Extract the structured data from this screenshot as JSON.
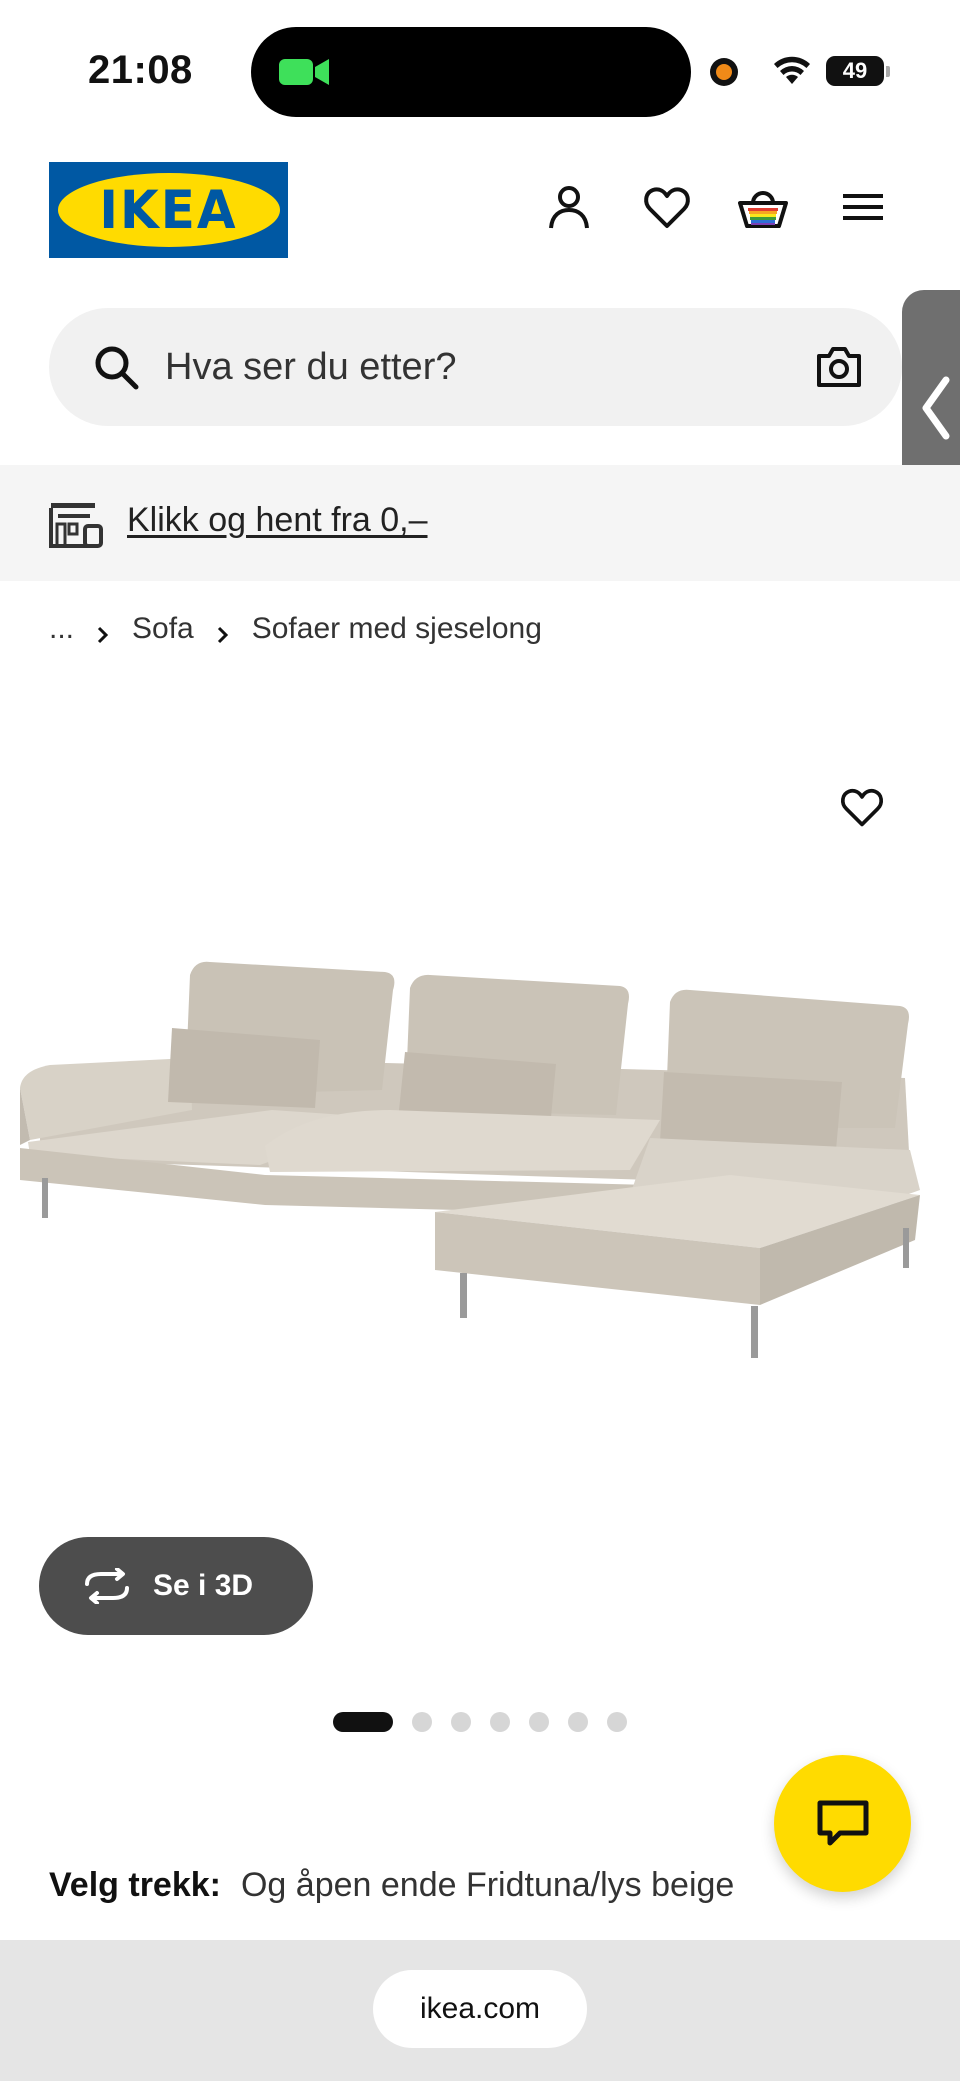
{
  "status_bar": {
    "time": "21:08",
    "battery": "49"
  },
  "header": {
    "logo_text": "IKEA",
    "icons": [
      "profile-icon",
      "heart-icon",
      "basket-icon",
      "menu-icon"
    ]
  },
  "search": {
    "placeholder": "Hva ser du etter?"
  },
  "banner": {
    "link_text": "Klikk og hent fra 0,–"
  },
  "breadcrumb": {
    "items": [
      "...",
      "Sofa",
      "Sofaer med sjeselong"
    ]
  },
  "product": {
    "view_3d_label": "Se i 3D",
    "image_count": 7,
    "active_image": 1,
    "cover_label": "Velg trekk:",
    "cover_value": "Og åpen ende Fridtuna/lys beige"
  },
  "browser": {
    "url": "ikea.com"
  },
  "colors": {
    "ikea_blue": "#0058a3",
    "ikea_yellow": "#ffdb00",
    "dark_button": "#4d4d4d"
  }
}
